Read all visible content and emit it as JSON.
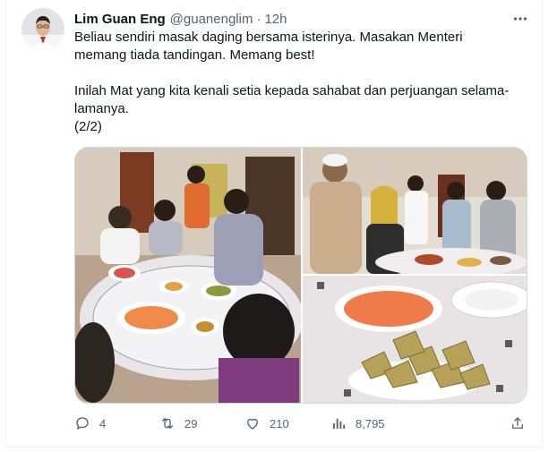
{
  "tweet": {
    "author_name": "Lim Guan Eng",
    "author_handle": "@guanenglim",
    "separator": "·",
    "time": "12h",
    "text_line1": "Beliau sendiri masak daging bersama isterinya. Masakan Menteri",
    "text_line2": "memang tiada tandingan. Memang best!",
    "text_line3": "Inilah Mat yang kita kenali setia kepada sahabat dan perjuangan selama-",
    "text_line4": "lamanya.",
    "text_line5": "(2/2)"
  },
  "actions": {
    "replies": "4",
    "retweets": "29",
    "likes": "210",
    "views": "8,795"
  },
  "icons": {
    "more": "more-icon",
    "reply": "reply-icon",
    "retweet": "retweet-icon",
    "like": "heart-icon",
    "views": "views-icon",
    "share": "share-icon"
  },
  "colors": {
    "text": "#0f1419",
    "muted": "#536471",
    "border": "#cfd9de"
  }
}
